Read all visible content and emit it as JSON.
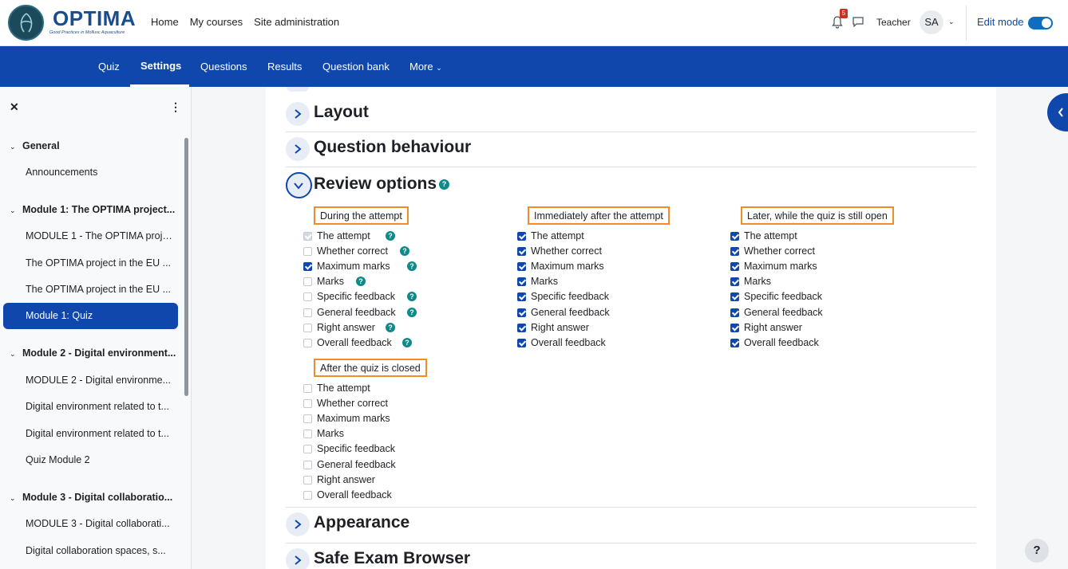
{
  "brand": {
    "name": "OPTIMA",
    "tagline": "Good Practices in Mollusc Aquaculture"
  },
  "primary_nav": [
    "Home",
    "My courses",
    "Site administration"
  ],
  "notifications": {
    "count": "5"
  },
  "user": {
    "role": "Teacher",
    "initials": "SA"
  },
  "edit_mode": {
    "label": "Edit mode",
    "on": true
  },
  "secondary_nav": {
    "items": [
      "Quiz",
      "Settings",
      "Questions",
      "Results",
      "Question bank",
      "More"
    ],
    "active": "Settings"
  },
  "drawer": {
    "sections": [
      {
        "title": "General",
        "items": [
          "Announcements"
        ]
      },
      {
        "title": "Module 1: The OPTIMA project...",
        "items": [
          "MODULE 1 - The OPTIMA proje...",
          "The OPTIMA project in the EU ...",
          "The OPTIMA project in the EU ...",
          "Module 1: Quiz"
        ]
      },
      {
        "title": "Module 2 - Digital environment...",
        "items": [
          "MODULE 2 - Digital environme...",
          "Digital environment related to t...",
          "Digital environment related to t...",
          "Quiz Module 2"
        ]
      },
      {
        "title": "Module 3 - Digital collaboratio...",
        "items": [
          "MODULE 3 - Digital collaborati...",
          "Digital collaboration spaces, s..."
        ]
      }
    ],
    "active_item": "Module 1: Quiz"
  },
  "sections": {
    "layout": "Layout",
    "question_behaviour": "Question behaviour",
    "review_options": "Review options",
    "appearance": "Appearance",
    "safe_exam_browser": "Safe Exam Browser"
  },
  "review": {
    "options": [
      "The attempt",
      "Whether correct",
      "Maximum marks",
      "Marks",
      "Specific feedback",
      "General feedback",
      "Right answer",
      "Overall feedback"
    ],
    "columns": [
      {
        "heading": "During the attempt",
        "checked": [
          true,
          false,
          true,
          false,
          false,
          false,
          false,
          false
        ],
        "disabled": [
          true,
          false,
          false,
          false,
          false,
          false,
          false,
          false
        ],
        "help": true
      },
      {
        "heading": "Immediately after the attempt",
        "checked": [
          true,
          true,
          true,
          true,
          true,
          true,
          true,
          true
        ],
        "disabled": [
          false,
          false,
          false,
          false,
          false,
          false,
          false,
          false
        ],
        "help": false
      },
      {
        "heading": "Later, while the quiz is still open",
        "checked": [
          true,
          true,
          true,
          true,
          true,
          true,
          true,
          true
        ],
        "disabled": [
          false,
          false,
          false,
          false,
          false,
          false,
          false,
          false
        ],
        "help": false
      },
      {
        "heading": "After the quiz is closed",
        "checked": [
          false,
          false,
          false,
          false,
          false,
          false,
          false,
          false
        ],
        "disabled": [
          false,
          false,
          false,
          false,
          false,
          false,
          false,
          false
        ],
        "help": false
      }
    ]
  },
  "colors": {
    "primary": "#0f47ad",
    "highlight_border": "#f28c28",
    "help_icon": "#0f8a8a"
  }
}
